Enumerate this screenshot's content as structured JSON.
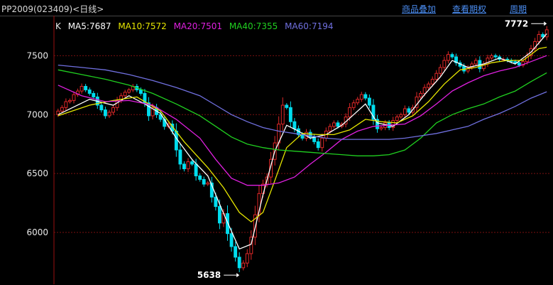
{
  "header": {
    "title": "PP2009(023409)<日线>",
    "buttons": [
      "商品叠加",
      "查看期权",
      "周期"
    ]
  },
  "legend": {
    "k_label": "K",
    "items": [
      {
        "text": "MA5:7687",
        "color": "#ffffff"
      },
      {
        "text": "MA10:7572",
        "color": "#e6e600"
      },
      {
        "text": "MA20:7501",
        "color": "#e020e0"
      },
      {
        "text": "MA40:7355",
        "color": "#20d020"
      },
      {
        "text": "MA60:7194",
        "color": "#7070e0"
      }
    ]
  },
  "colors": {
    "up": "#e02828",
    "down": "#00ddee",
    "grid": "#7a1010",
    "axis": "#9a1010"
  },
  "chart_data": {
    "type": "candlestick",
    "y_ticks": [
      6000,
      6500,
      7000,
      7500
    ],
    "ylim": [
      5560,
      7840
    ],
    "annotations": [
      {
        "text": "7772",
        "value": 7772
      },
      {
        "text": "5638",
        "value": 5638
      }
    ],
    "close_series": [
      7030,
      7060,
      7110,
      7120,
      7170,
      7200,
      7240,
      7210,
      7180,
      7150,
      7080,
      7040,
      6990,
      7020,
      7060,
      7120,
      7160,
      7190,
      7210,
      7240,
      7210,
      7180,
      7100,
      6990,
      7060,
      7000,
      6960,
      6900,
      6920,
      6860,
      6700,
      6580,
      6540,
      6600,
      6580,
      6480,
      6450,
      6410,
      6420,
      6300,
      6220,
      6080,
      6160,
      5990,
      5880,
      5790,
      5700,
      5740,
      5820,
      5960,
      6150,
      6330,
      6410,
      6470,
      6620,
      6760,
      6920,
      7080,
      7060,
      6940,
      6880,
      6830,
      6800,
      6850,
      6810,
      6770,
      6720,
      6800,
      6860,
      6900,
      6930,
      6900,
      6920,
      6980,
      7060,
      7100,
      7130,
      7170,
      7140,
      7080,
      6960,
      6880,
      6890,
      6930,
      6890,
      6950,
      6980,
      7000,
      7050,
      7020,
      7060,
      7150,
      7180,
      7230,
      7260,
      7300,
      7350,
      7400,
      7460,
      7510,
      7490,
      7440,
      7410,
      7370,
      7400,
      7430,
      7460,
      7390,
      7430,
      7480,
      7500,
      7490,
      7470,
      7470,
      7460,
      7450,
      7440,
      7420,
      7450,
      7500,
      7560,
      7620,
      7680,
      7660,
      7720
    ],
    "ma": [
      {
        "name": "MA5",
        "color": "#ffffff",
        "values": [
          [
            0,
            7000
          ],
          [
            8,
            7130
          ],
          [
            14,
            7080
          ],
          [
            18,
            7160
          ],
          [
            22,
            7090
          ],
          [
            26,
            7010
          ],
          [
            30,
            6800
          ],
          [
            34,
            6620
          ],
          [
            38,
            6480
          ],
          [
            42,
            6160
          ],
          [
            46,
            5860
          ],
          [
            49,
            5900
          ],
          [
            52,
            6320
          ],
          [
            55,
            6690
          ],
          [
            58,
            6910
          ],
          [
            61,
            6860
          ],
          [
            64,
            6800
          ],
          [
            68,
            6830
          ],
          [
            72,
            6910
          ],
          [
            75,
            7000
          ],
          [
            78,
            7090
          ],
          [
            81,
            6930
          ],
          [
            85,
            6900
          ],
          [
            89,
            7000
          ],
          [
            93,
            7170
          ],
          [
            97,
            7320
          ],
          [
            100,
            7460
          ],
          [
            104,
            7400
          ],
          [
            108,
            7430
          ],
          [
            112,
            7480
          ],
          [
            116,
            7430
          ],
          [
            120,
            7530
          ],
          [
            124,
            7687
          ]
        ]
      },
      {
        "name": "MA10",
        "color": "#e6e600",
        "values": [
          [
            0,
            6990
          ],
          [
            8,
            7080
          ],
          [
            14,
            7120
          ],
          [
            20,
            7150
          ],
          [
            26,
            7030
          ],
          [
            32,
            6770
          ],
          [
            38,
            6550
          ],
          [
            42,
            6380
          ],
          [
            46,
            6170
          ],
          [
            49,
            6090
          ],
          [
            52,
            6170
          ],
          [
            55,
            6440
          ],
          [
            58,
            6720
          ],
          [
            62,
            6840
          ],
          [
            66,
            6830
          ],
          [
            70,
            6830
          ],
          [
            74,
            6870
          ],
          [
            78,
            6960
          ],
          [
            82,
            6940
          ],
          [
            86,
            6930
          ],
          [
            90,
            6990
          ],
          [
            94,
            7110
          ],
          [
            98,
            7260
          ],
          [
            102,
            7380
          ],
          [
            106,
            7400
          ],
          [
            110,
            7440
          ],
          [
            114,
            7460
          ],
          [
            118,
            7460
          ],
          [
            122,
            7560
          ],
          [
            124,
            7572
          ]
        ]
      },
      {
        "name": "MA20",
        "color": "#e020e0",
        "values": [
          [
            0,
            7250
          ],
          [
            6,
            7160
          ],
          [
            12,
            7110
          ],
          [
            18,
            7120
          ],
          [
            24,
            7080
          ],
          [
            30,
            6960
          ],
          [
            36,
            6800
          ],
          [
            40,
            6620
          ],
          [
            44,
            6460
          ],
          [
            48,
            6400
          ],
          [
            52,
            6400
          ],
          [
            56,
            6420
          ],
          [
            60,
            6470
          ],
          [
            64,
            6580
          ],
          [
            68,
            6680
          ],
          [
            72,
            6790
          ],
          [
            76,
            6860
          ],
          [
            80,
            6900
          ],
          [
            84,
            6910
          ],
          [
            88,
            6920
          ],
          [
            92,
            6990
          ],
          [
            96,
            7090
          ],
          [
            100,
            7200
          ],
          [
            104,
            7270
          ],
          [
            108,
            7330
          ],
          [
            112,
            7370
          ],
          [
            116,
            7400
          ],
          [
            120,
            7450
          ],
          [
            124,
            7501
          ]
        ]
      },
      {
        "name": "MA40",
        "color": "#20d020",
        "values": [
          [
            0,
            7380
          ],
          [
            6,
            7340
          ],
          [
            12,
            7300
          ],
          [
            18,
            7250
          ],
          [
            24,
            7180
          ],
          [
            30,
            7090
          ],
          [
            36,
            6990
          ],
          [
            40,
            6900
          ],
          [
            44,
            6810
          ],
          [
            48,
            6750
          ],
          [
            52,
            6720
          ],
          [
            56,
            6700
          ],
          [
            60,
            6690
          ],
          [
            64,
            6680
          ],
          [
            68,
            6670
          ],
          [
            72,
            6660
          ],
          [
            76,
            6650
          ],
          [
            80,
            6650
          ],
          [
            84,
            6660
          ],
          [
            88,
            6700
          ],
          [
            92,
            6800
          ],
          [
            96,
            6930
          ],
          [
            100,
            7000
          ],
          [
            104,
            7050
          ],
          [
            108,
            7090
          ],
          [
            112,
            7150
          ],
          [
            116,
            7200
          ],
          [
            120,
            7280
          ],
          [
            124,
            7355
          ]
        ]
      },
      {
        "name": "MA60",
        "color": "#7070e0",
        "values": [
          [
            0,
            7420
          ],
          [
            6,
            7400
          ],
          [
            12,
            7380
          ],
          [
            18,
            7340
          ],
          [
            24,
            7290
          ],
          [
            30,
            7230
          ],
          [
            36,
            7160
          ],
          [
            40,
            7080
          ],
          [
            44,
            7000
          ],
          [
            48,
            6940
          ],
          [
            52,
            6890
          ],
          [
            56,
            6860
          ],
          [
            60,
            6840
          ],
          [
            64,
            6820
          ],
          [
            68,
            6800
          ],
          [
            72,
            6790
          ],
          [
            76,
            6790
          ],
          [
            80,
            6790
          ],
          [
            84,
            6790
          ],
          [
            88,
            6800
          ],
          [
            92,
            6820
          ],
          [
            96,
            6840
          ],
          [
            100,
            6870
          ],
          [
            104,
            6900
          ],
          [
            108,
            6960
          ],
          [
            112,
            7010
          ],
          [
            116,
            7070
          ],
          [
            120,
            7140
          ],
          [
            124,
            7194
          ]
        ]
      }
    ]
  }
}
